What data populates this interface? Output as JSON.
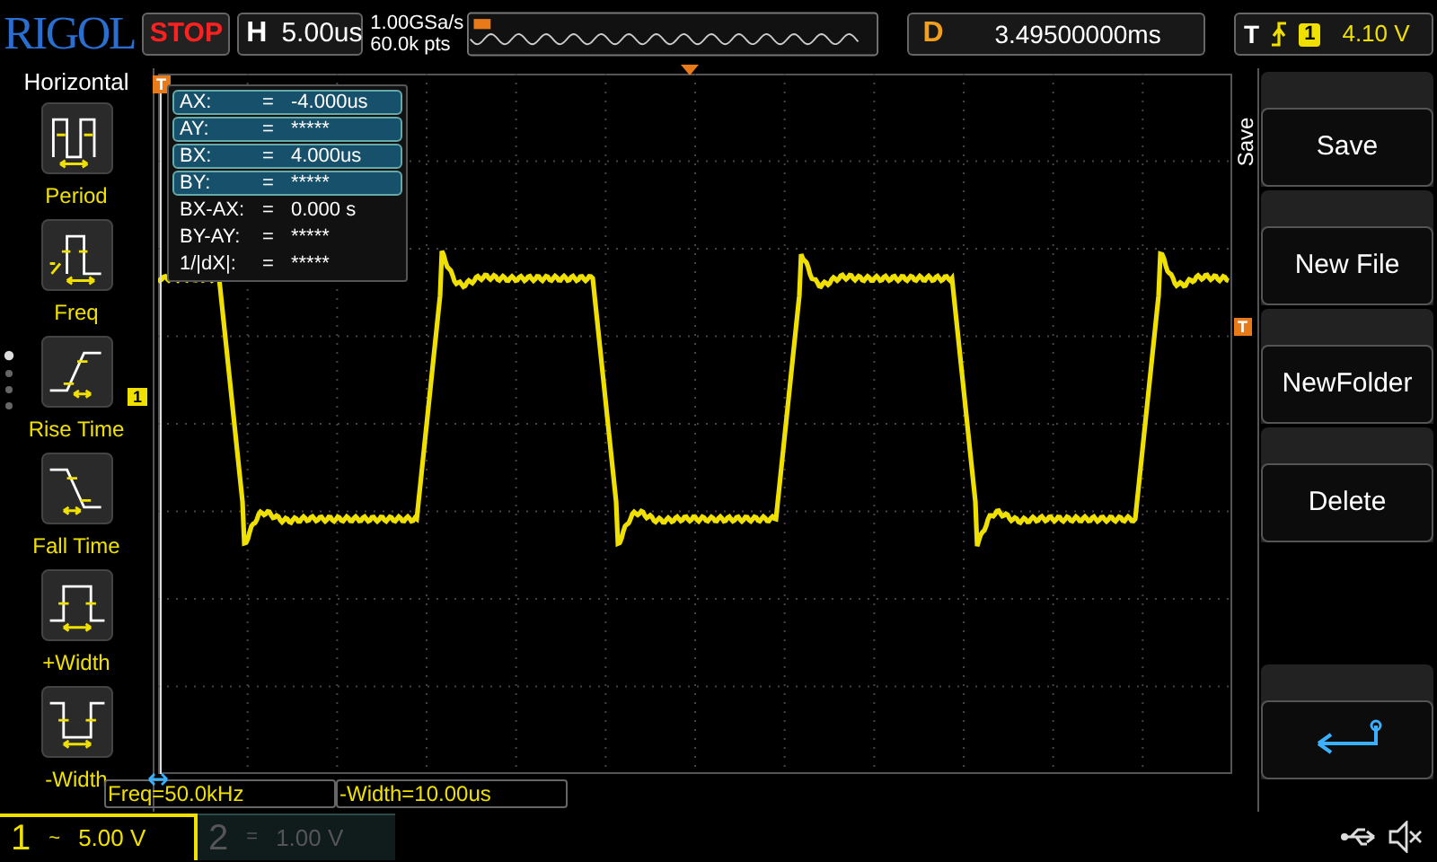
{
  "top_bar": {
    "logo": "RIGOL",
    "run_state": "STOP",
    "horizontal": {
      "label": "H",
      "timebase": "5.00us"
    },
    "sample_rate": "1.00GSa/s",
    "memory_depth": "60.0k pts",
    "delay": {
      "label": "D",
      "value": "3.49500000ms"
    },
    "trigger": {
      "label": "T",
      "source": "1",
      "level": "4.10 V"
    }
  },
  "measure_panel": {
    "title": "Horizontal",
    "items": [
      {
        "kind": "period",
        "label": "Period"
      },
      {
        "kind": "freq",
        "label": "Freq"
      },
      {
        "kind": "rise",
        "label": "Rise Time"
      },
      {
        "kind": "fall",
        "label": "Fall Time"
      },
      {
        "kind": "pwidth",
        "label": "+Width"
      },
      {
        "kind": "nwidth",
        "label": "-Width"
      }
    ]
  },
  "cursor_readout": [
    {
      "name": "AX:",
      "eq": "=",
      "value": "-4.000us",
      "highlighted": true
    },
    {
      "name": "AY:",
      "eq": "=",
      "value": "*****",
      "highlighted": true
    },
    {
      "name": "BX:",
      "eq": "=",
      "value": "4.000us",
      "highlighted": true
    },
    {
      "name": "BY:",
      "eq": "=",
      "value": "*****",
      "highlighted": true
    },
    {
      "name": "BX-AX:",
      "eq": "=",
      "value": "0.000 s",
      "highlighted": false
    },
    {
      "name": "BY-AY:",
      "eq": "=",
      "value": "*****",
      "highlighted": false
    },
    {
      "name": "1/|dX|:",
      "eq": "=",
      "value": "*****",
      "highlighted": false
    }
  ],
  "markers": {
    "trigger_position": "T",
    "trigger_level": "T",
    "channel": "1"
  },
  "measurements": [
    "Freq=50.0kHz",
    "-Width=10.00us"
  ],
  "menu": {
    "title": "Save",
    "buttons": [
      {
        "kind": "text",
        "label": "Save"
      },
      {
        "kind": "text",
        "label": "New File"
      },
      {
        "kind": "text",
        "label": "NewFolder"
      },
      {
        "kind": "text",
        "label": "Delete"
      },
      {
        "kind": "empty"
      },
      {
        "kind": "return"
      }
    ]
  },
  "channels": [
    {
      "number": "1",
      "coupling": "~",
      "scale": "5.00 V",
      "enabled": true
    },
    {
      "number": "2",
      "coupling": "=",
      "scale": "1.00 V",
      "enabled": false
    }
  ]
}
